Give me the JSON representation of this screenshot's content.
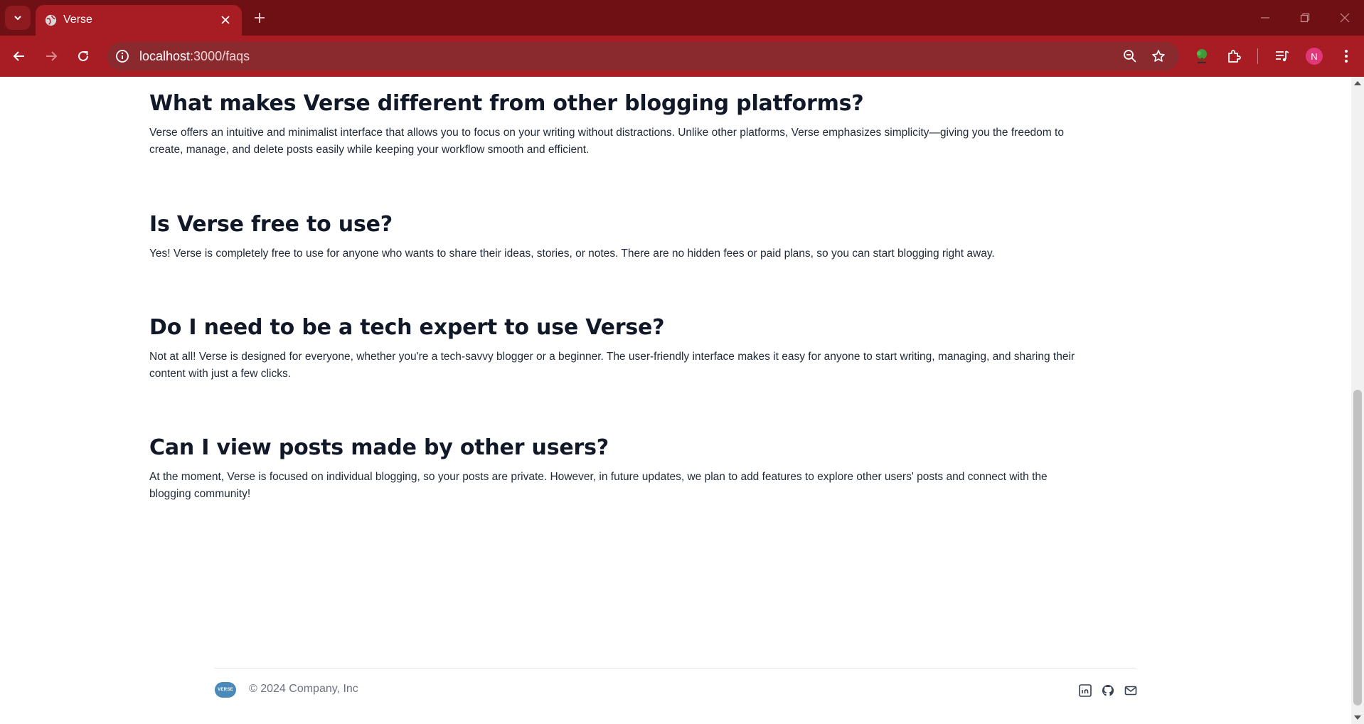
{
  "browser": {
    "tab_title": "Verse",
    "url_host": "localhost",
    "url_path": ":3000/faqs",
    "avatar_letter": "N",
    "theme_color": "#a81c23"
  },
  "faqs": [
    {
      "question": "What makes Verse different from other blogging platforms?",
      "answer": "Verse offers an intuitive and minimalist interface that allows you to focus on your writing without distractions. Unlike other platforms, Verse emphasizes simplicity—giving you the freedom to create, manage, and delete posts easily while keeping your workflow smooth and efficient."
    },
    {
      "question": "Is Verse free to use?",
      "answer": "Yes! Verse is completely free to use for anyone who wants to share their ideas, stories, or notes. There are no hidden fees or paid plans, so you can start blogging right away."
    },
    {
      "question": "Do I need to be a tech expert to use Verse?",
      "answer": "Not at all! Verse is designed for everyone, whether you're a tech-savvy blogger or a beginner. The user-friendly interface makes it easy for anyone to start writing, managing, and sharing their content with just a few clicks."
    },
    {
      "question": "Can I view posts made by other users?",
      "answer": "At the moment, Verse is focused on individual blogging, so your posts are private. However, in future updates, we plan to add features to explore other users' posts and connect with the blogging community!"
    }
  ],
  "footer": {
    "logo_text": "VERSE",
    "copyright": "© 2024 Company, Inc",
    "social": [
      "linkedin-icon",
      "github-icon",
      "mail-icon"
    ]
  }
}
